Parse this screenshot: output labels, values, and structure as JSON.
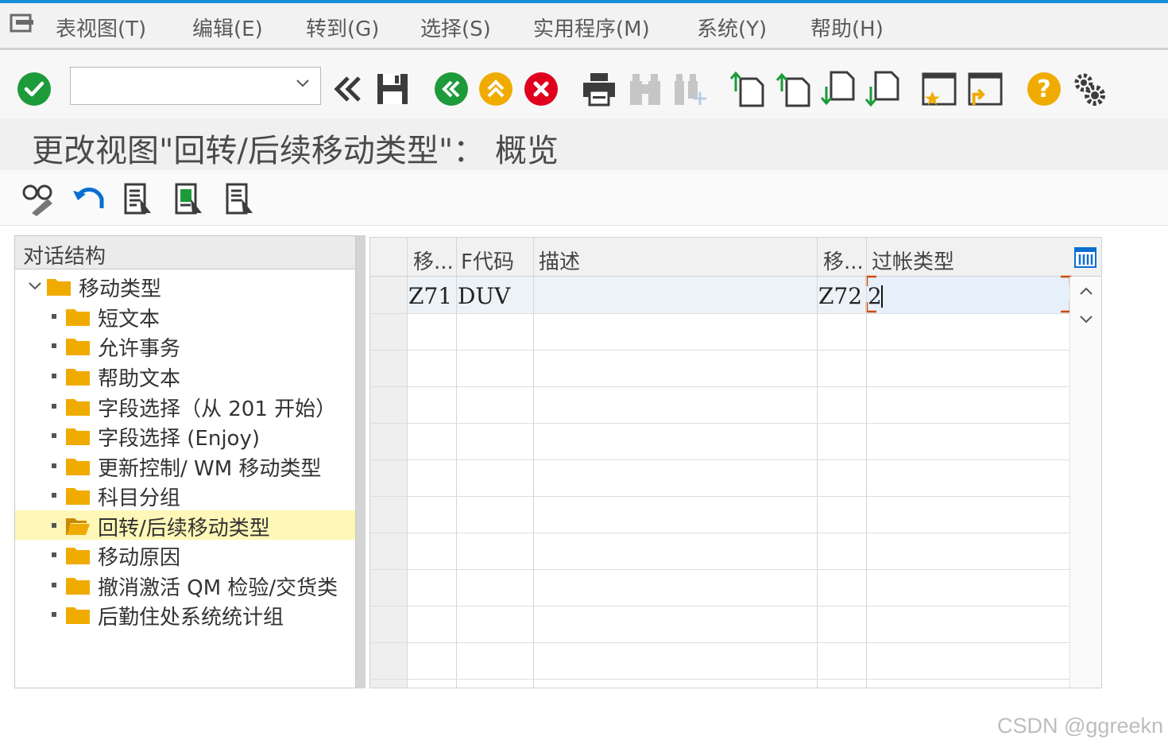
{
  "menubar": {
    "items": [
      "表视图(T)",
      "编辑(E)",
      "转到(G)",
      "选择(S)",
      "实用程序(M)",
      "系统(Y)",
      "帮助(H)"
    ]
  },
  "toolbar": {
    "command_field": "",
    "icons": [
      "enter-icon",
      "back-icon",
      "save-icon",
      "back-nav-icon",
      "exit-icon",
      "cancel-icon",
      "print-icon",
      "find-icon",
      "find-next-icon",
      "first-page-icon",
      "previous-page-icon",
      "next-page-icon",
      "last-page-icon",
      "create-session-icon",
      "shortcut-icon",
      "help-icon",
      "settings-icon"
    ]
  },
  "title": "更改视图\"回转/后续移动类型\"：  概览",
  "tree": {
    "header": "对话结构",
    "root": "移动类型",
    "items": [
      {
        "label": "短文本"
      },
      {
        "label": "允许事务"
      },
      {
        "label": "帮助文本"
      },
      {
        "label": "字段选择（从 201 开始）"
      },
      {
        "label": "字段选择 (Enjoy)"
      },
      {
        "label": "更新控制/ WM 移动类型"
      },
      {
        "label": "科目分组"
      },
      {
        "label": "回转/后续移动类型",
        "selected": true
      },
      {
        "label": "移动原因"
      },
      {
        "label": "撤消激活 QM 检验/交货类"
      },
      {
        "label": "后勤住处系统统计组"
      }
    ]
  },
  "table": {
    "headers": [
      "移...",
      "F代码",
      "描述",
      "移...",
      "过帐类型"
    ],
    "rows": [
      [
        "Z71",
        "DUV",
        "",
        "Z72",
        "2"
      ]
    ]
  },
  "watermark": "CSDN @ggreekn"
}
